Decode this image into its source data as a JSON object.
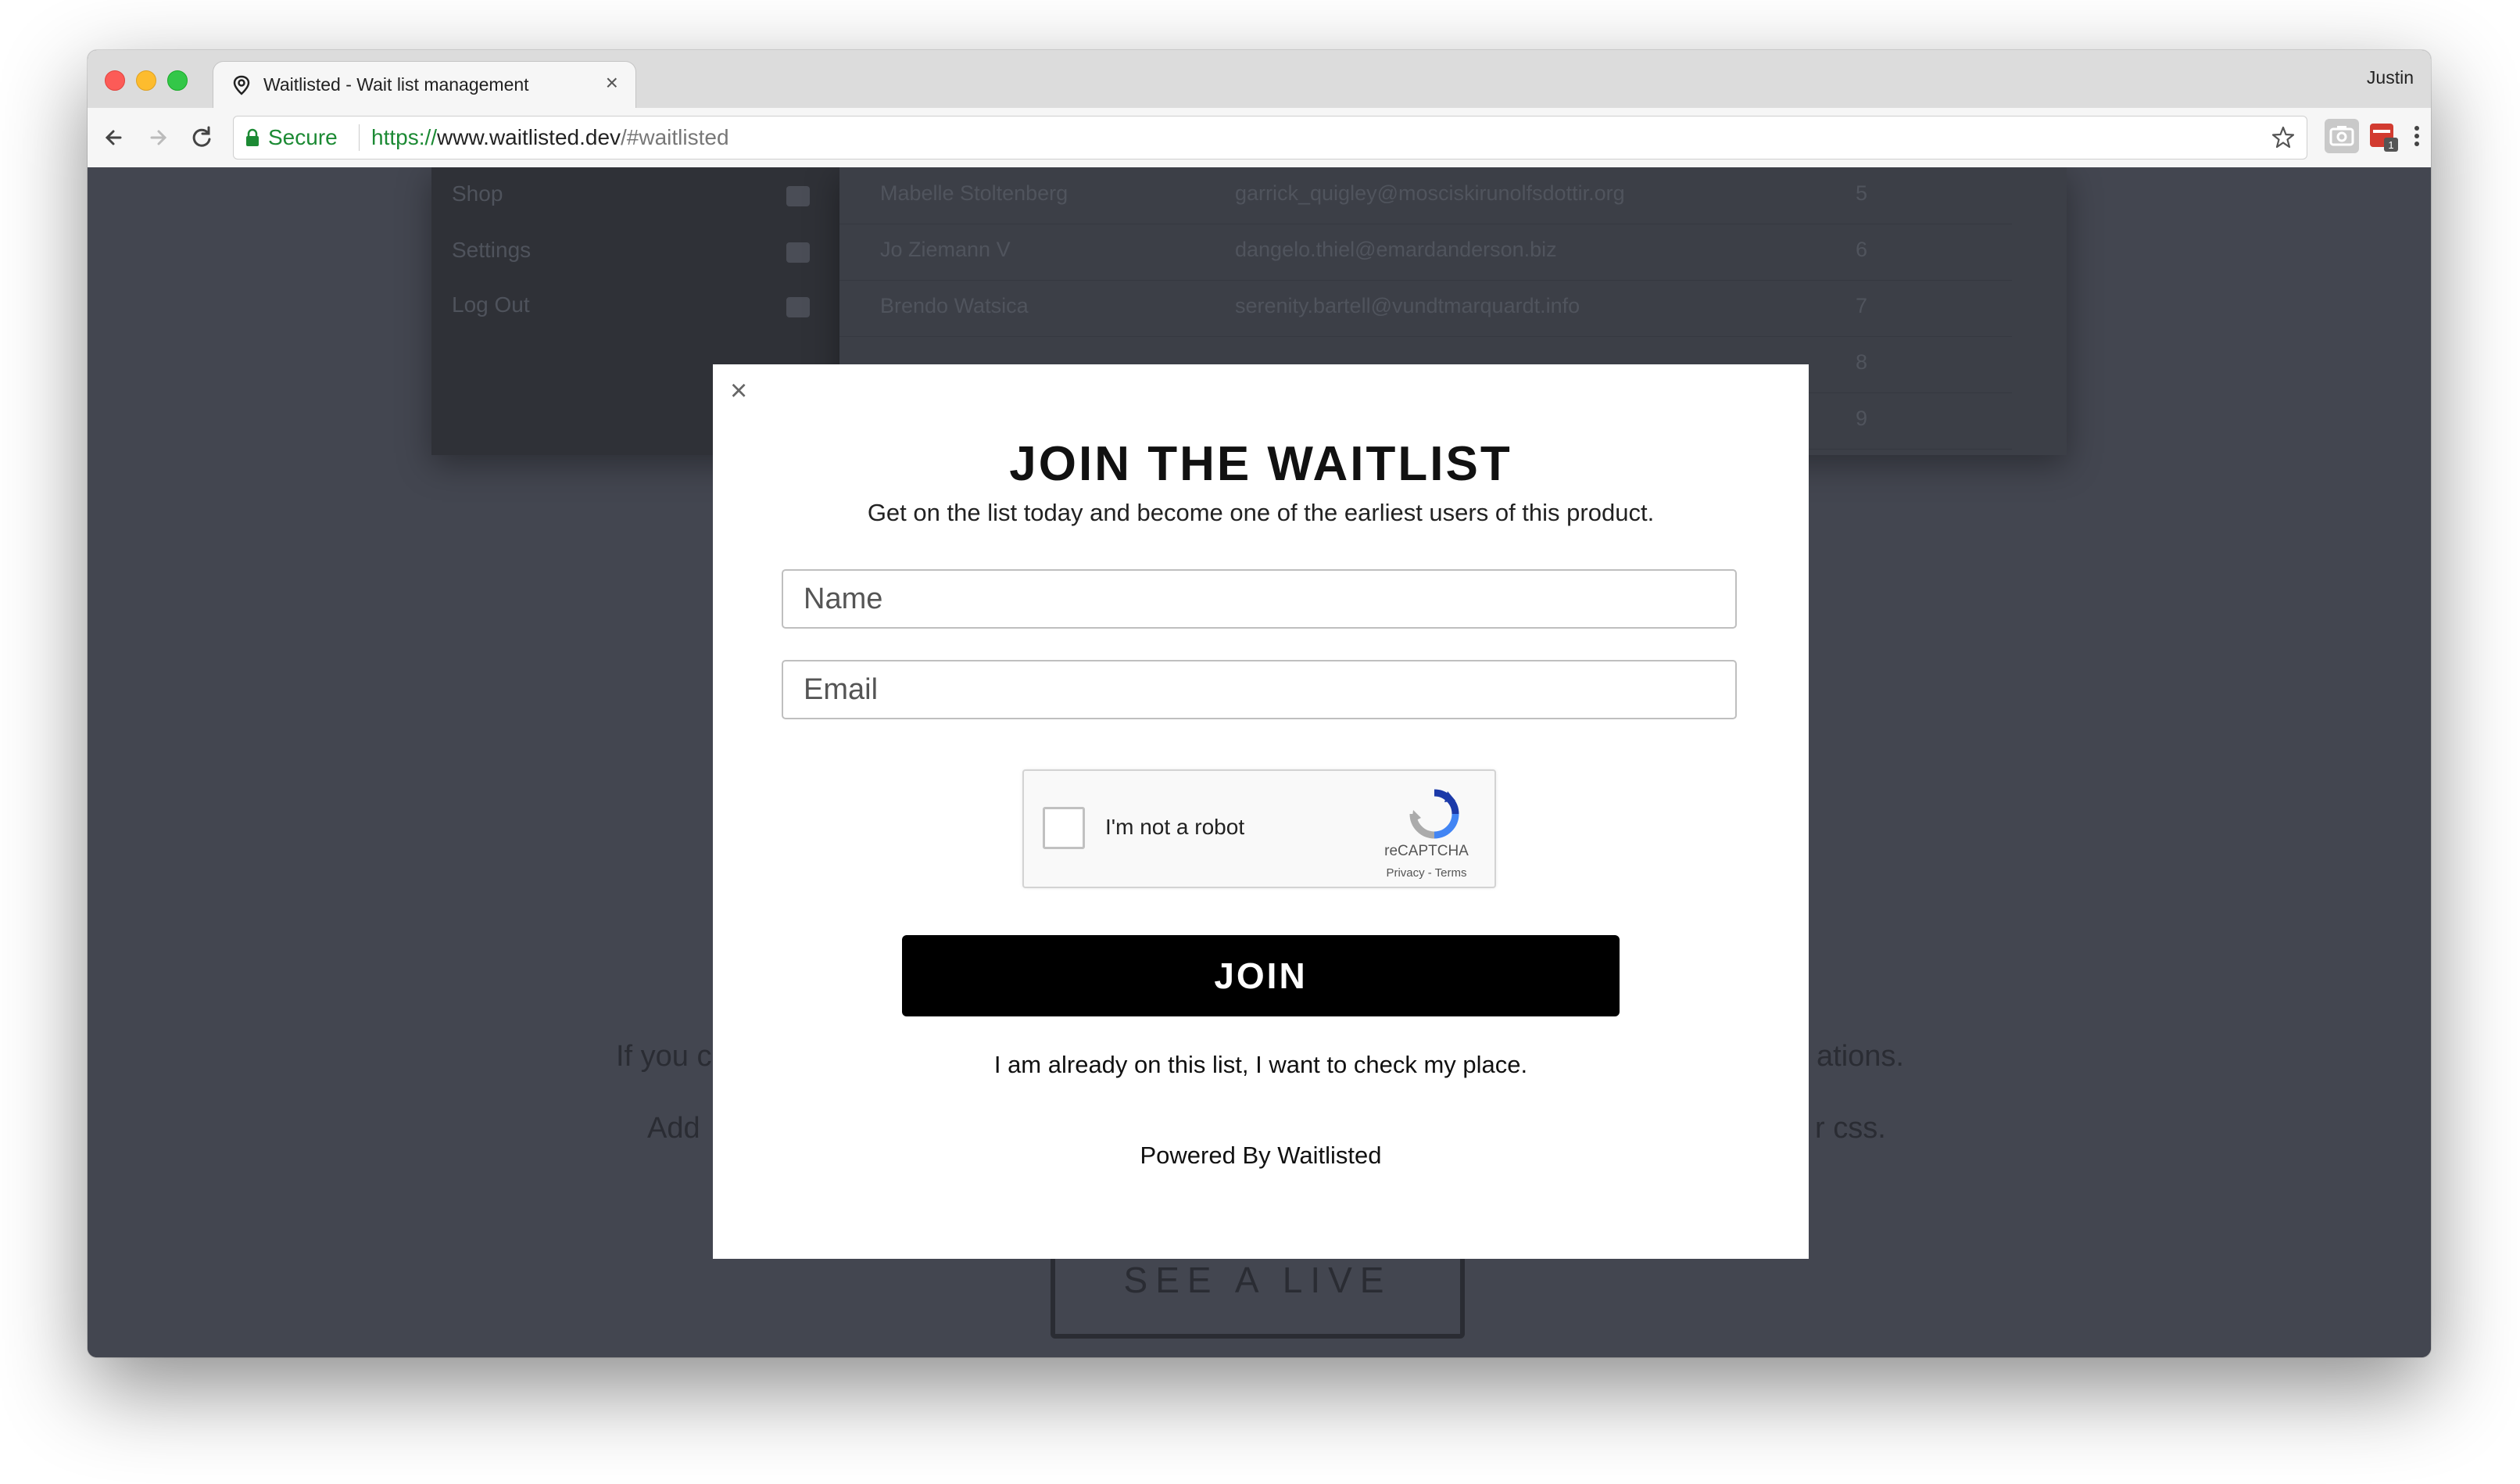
{
  "browser": {
    "tab_title": "Waitlisted - Wait list management",
    "tab_close": "×",
    "profile_name": "Justin",
    "secure_label": "Secure",
    "url_scheme": "https://",
    "url_host": "www.waitlisted.dev",
    "url_rest": "/#waitlisted",
    "secure_color": "#1c8a34"
  },
  "background": {
    "sidebar_items": [
      {
        "label": "Shop",
        "icon": "cart-icon"
      },
      {
        "label": "Settings",
        "icon": "gears-icon"
      },
      {
        "label": "Log Out",
        "icon": "logout-icon"
      }
    ],
    "table_rows": [
      {
        "name": "Mabelle Stoltenberg",
        "email": "garrick_quigley@mosciskirunolfsdottir.org",
        "num": "5"
      },
      {
        "name": "Jo Ziemann V",
        "email": "dangelo.thiel@emardanderson.biz",
        "num": "6"
      },
      {
        "name": "Brendo Watsica",
        "email": "serenity.bartell@vundtmarquardt.info",
        "num": "7"
      },
      {
        "name": "",
        "email": "",
        "num": "8"
      },
      {
        "name": "",
        "email": "",
        "num": "9"
      }
    ],
    "text_line_1_left": "If you c",
    "text_line_1_right": "ations.",
    "text_line_2_left": "Add",
    "text_line_2_right": "r css.",
    "demo_button": "SEE A LIVE DEMO"
  },
  "modal": {
    "close_symbol": "×",
    "title": "JOIN THE WAITLIST",
    "subtitle": "Get on the list today and become one of the earliest users of this product.",
    "name_placeholder": "Name",
    "email_placeholder": "Email",
    "recaptcha": {
      "label": "I'm not a robot",
      "brand": "reCAPTCHA",
      "links": "Privacy - Terms"
    },
    "join_button": "JOIN",
    "check_place_link": "I am already on this list, I want to check my place.",
    "powered_by": "Powered By Waitlisted"
  }
}
